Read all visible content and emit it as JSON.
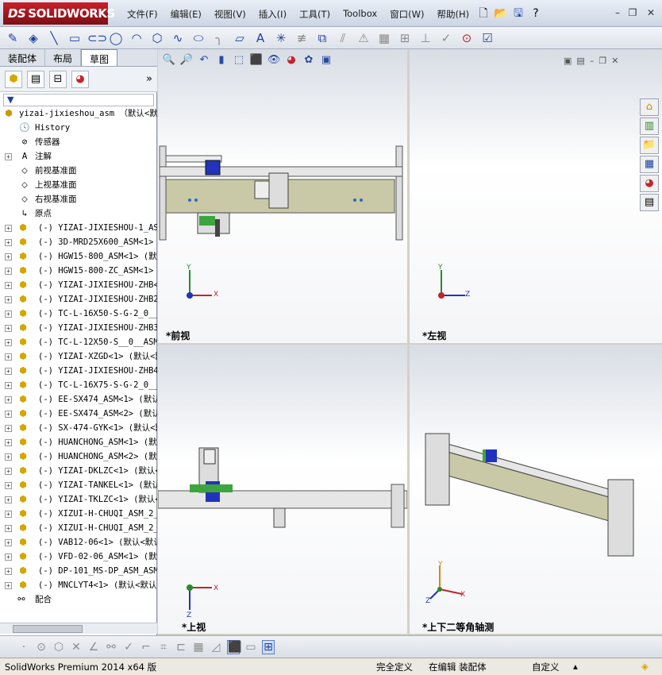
{
  "app": {
    "logo": "SOLIDWORKS",
    "ds": "DS"
  },
  "menu": [
    "文件(F)",
    "编辑(E)",
    "视图(V)",
    "插入(I)",
    "工具(T)",
    "Toolbox",
    "窗口(W)",
    "帮助(H)"
  ],
  "tabs": [
    "装配体",
    "布局",
    "草图"
  ],
  "tree": {
    "root": "yizai-jixieshou_asm （默认<默",
    "features": [
      "History",
      "传感器",
      "注解",
      "前视基准面",
      "上视基准面",
      "右视基准面",
      "原点"
    ],
    "components": [
      "(-) YIZAI-JIXIESHOU-1_ASM<",
      "(-) 3D-MRD25X600_ASM<1> (",
      "(-) HGW15-800_ASM<1> (默认",
      "(-) HGW15-800-ZC_ASM<1> (",
      "(-) YIZAI-JIXIESHOU-ZHB<1>",
      "(-) YIZAI-JIXIESHOU-ZHB2<",
      "(-) TC-L-16X50-S-G-2_0__AS",
      "(-) YIZAI-JIXIESHOU-ZHB3<",
      "(-) TC-L-12X50-S__0__ASM<",
      "(-) YIZAI-XZGD<1> (默认<默",
      "(-) YIZAI-JIXIESHOU-ZHB4<",
      "(-) TC-L-16X75-S-G-2_0__AS",
      "(-) EE-SX474_ASM<1> (默认",
      "(-) EE-SX474_ASM<2> (默认",
      "(-) SX-474-GYK<1> (默认<默",
      "(-) HUANCHONG_ASM<1> (默认",
      "(-) HUANCHONG_ASM<2> (默认",
      "(-) YIZAI-DKLZC<1> (默认<",
      "(-) YIZAI-TANKEL<1> (默认<",
      "(-) YIZAI-TKLZC<1> (默认<",
      "(-) XIZUI-H-CHUQI_ASM_2_AS",
      "(-) XIZUI-H-CHUQI_ASM_2_AS",
      "(-) VAB12-06<1> (默认<默认",
      "(-) VFD-02-06_ASM<1> (默认",
      "(-) DP-101_MS-DP_ASM_ASM<",
      "(-) MNCLYT4<1> (默认<默认"
    ],
    "mates": "配合"
  },
  "viewports": {
    "front": "*前视",
    "left": "*左视",
    "top": "*上视",
    "iso": "*上下二等角轴测"
  },
  "axes": {
    "x": "X",
    "y": "Y",
    "z": "Z"
  },
  "status": {
    "product": "SolidWorks Premium 2014 x64 版",
    "definition": "完全定义",
    "editing": "在编辑 装配体",
    "units": "自定义"
  }
}
